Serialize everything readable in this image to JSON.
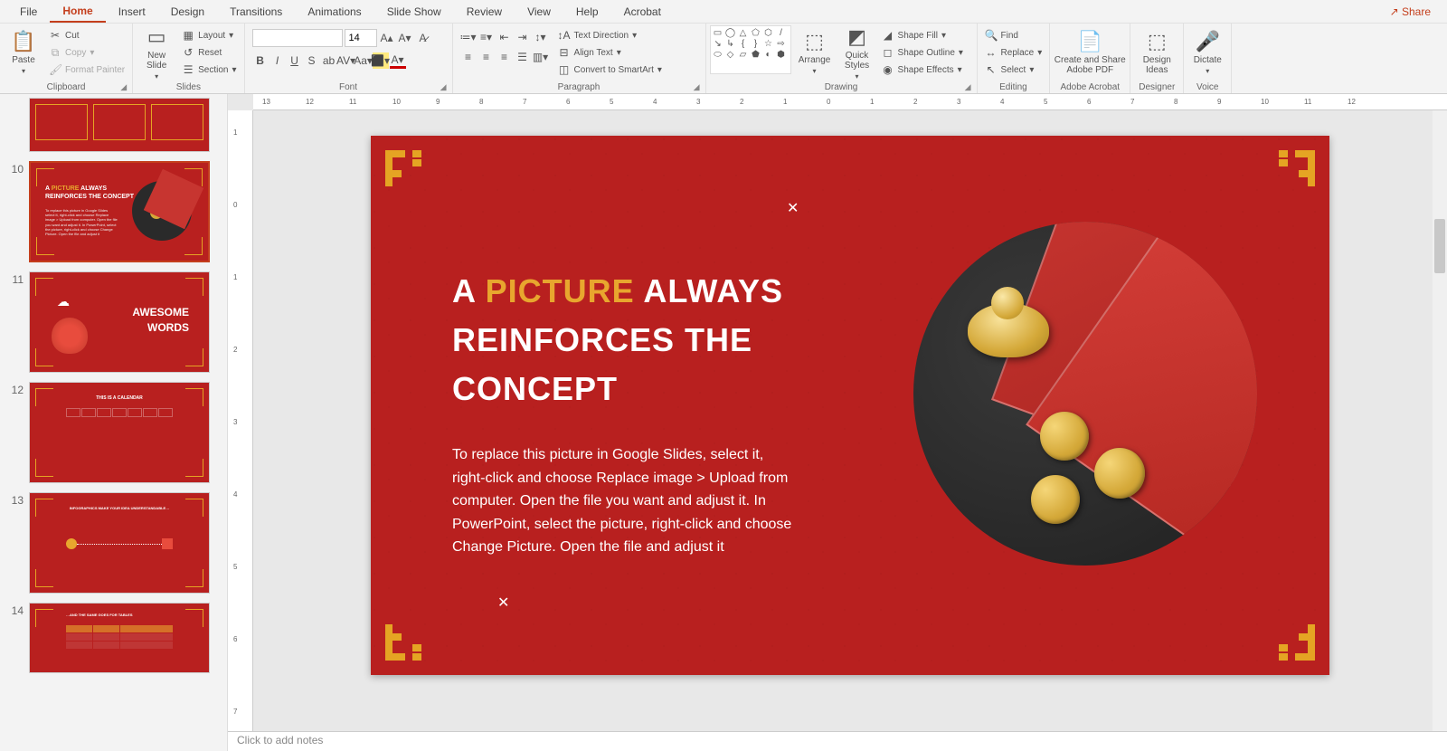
{
  "menubar": {
    "tabs": [
      "File",
      "Home",
      "Insert",
      "Design",
      "Transitions",
      "Animations",
      "Slide Show",
      "Review",
      "View",
      "Help",
      "Acrobat"
    ],
    "active": "Home",
    "share": "Share"
  },
  "ribbon": {
    "clipboard": {
      "label": "Clipboard",
      "paste": "Paste",
      "cut": "Cut",
      "copy": "Copy",
      "format_painter": "Format Painter"
    },
    "slides": {
      "label": "Slides",
      "new_slide": "New\nSlide",
      "layout": "Layout",
      "reset": "Reset",
      "section": "Section"
    },
    "font": {
      "label": "Font",
      "size": "14"
    },
    "paragraph": {
      "label": "Paragraph",
      "text_direction": "Text Direction",
      "align_text": "Align Text",
      "convert_smartart": "Convert to SmartArt"
    },
    "drawing": {
      "label": "Drawing",
      "arrange": "Arrange",
      "quick_styles": "Quick\nStyles",
      "shape_fill": "Shape Fill",
      "shape_outline": "Shape Outline",
      "shape_effects": "Shape Effects"
    },
    "editing": {
      "label": "Editing",
      "find": "Find",
      "replace": "Replace",
      "select": "Select"
    },
    "acrobat": {
      "label": "Adobe Acrobat",
      "create_share": "Create and Share\nAdobe PDF"
    },
    "designer": {
      "label": "Designer",
      "design_ideas": "Design\nIdeas"
    },
    "voice": {
      "label": "Voice",
      "dictate": "Dictate"
    }
  },
  "ruler": {
    "h": [
      "13",
      "12",
      "11",
      "10",
      "9",
      "8",
      "7",
      "6",
      "5",
      "4",
      "3",
      "2",
      "1",
      "0",
      "1",
      "2",
      "3",
      "4",
      "5",
      "6",
      "7",
      "8",
      "9",
      "10",
      "11",
      "12"
    ],
    "v": [
      "1",
      "0",
      "1",
      "2",
      "3",
      "4",
      "5",
      "6",
      "7"
    ]
  },
  "thumbnails": [
    {
      "num": "",
      "title": "",
      "type": "grid"
    },
    {
      "num": "10",
      "title": "A PICTURE ALWAYS REINFORCES THE CONCEPT",
      "type": "picture",
      "selected": true
    },
    {
      "num": "11",
      "title": "AWESOME WORDS",
      "type": "words"
    },
    {
      "num": "12",
      "title": "THIS IS A CALENDAR",
      "type": "calendar"
    },
    {
      "num": "13",
      "title": "INFOGRAPHICS MAKE YOUR IDEA UNDERSTANDABLE…",
      "type": "infographic"
    },
    {
      "num": "14",
      "title": "…AND THE SAME GOES FOR TABLES",
      "type": "table"
    }
  ],
  "slide": {
    "title_pre": "A ",
    "title_hl": "PICTURE",
    "title_post": " ALWAYS",
    "title_line2": "REINFORCES THE CONCEPT",
    "body": "To replace this picture in Google Slides, select it, right-click and choose Replace image > Upload from computer. Open the file you want and adjust it. In PowerPoint, select the picture, right-click and choose Change Picture. Open the file and adjust it"
  },
  "notes_placeholder": "Click to add notes"
}
